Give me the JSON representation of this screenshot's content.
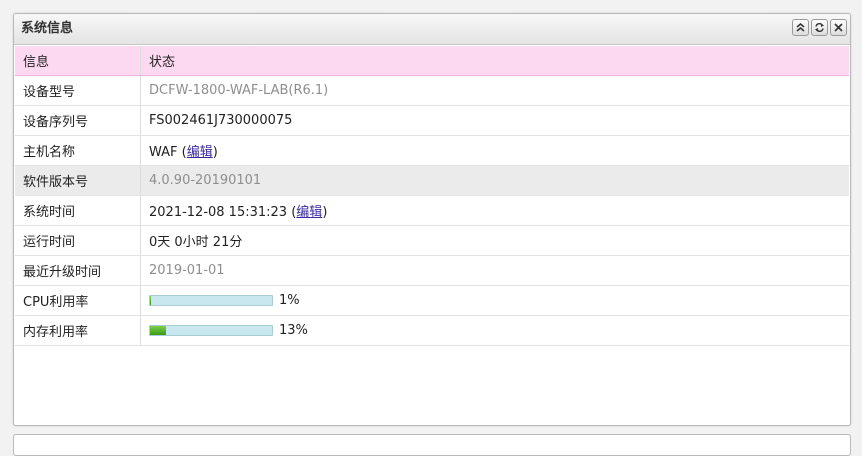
{
  "panel": {
    "title": "系统信息"
  },
  "table": {
    "headers": [
      "信息",
      "状态"
    ],
    "rows": {
      "model": {
        "label": "设备型号",
        "value": "DCFW-1800-WAF-LAB(R6.1)"
      },
      "serial": {
        "label": "设备序列号",
        "value": "FS002461J730000075"
      },
      "hostname": {
        "label": "主机名称",
        "value": "WAF",
        "link": "编辑"
      },
      "software": {
        "label": "软件版本号",
        "value": "4.0.90-20190101"
      },
      "systime": {
        "label": "系统时间",
        "value": "2021-12-08 15:31:23",
        "link": "编辑"
      },
      "uptime": {
        "label": "运行时间",
        "value": "0天 0小时 21分"
      },
      "upgrade": {
        "label": "最近升级时间",
        "value": "2019-01-01"
      },
      "cpu": {
        "label": "CPU利用率",
        "value": "1%",
        "fraction": 0.01
      },
      "mem": {
        "label": "内存利用率",
        "value": "13%",
        "fraction": 0.13
      }
    }
  },
  "icons": {
    "collapse": "double-chevron-up-icon",
    "refresh": "refresh-icon",
    "close": "close-icon"
  },
  "colors": {
    "header_row_bg": "#fdd9f1",
    "bar_track": "#c8e7ef",
    "bar_fill": "#4caf24",
    "link": "#3a2aa4"
  }
}
